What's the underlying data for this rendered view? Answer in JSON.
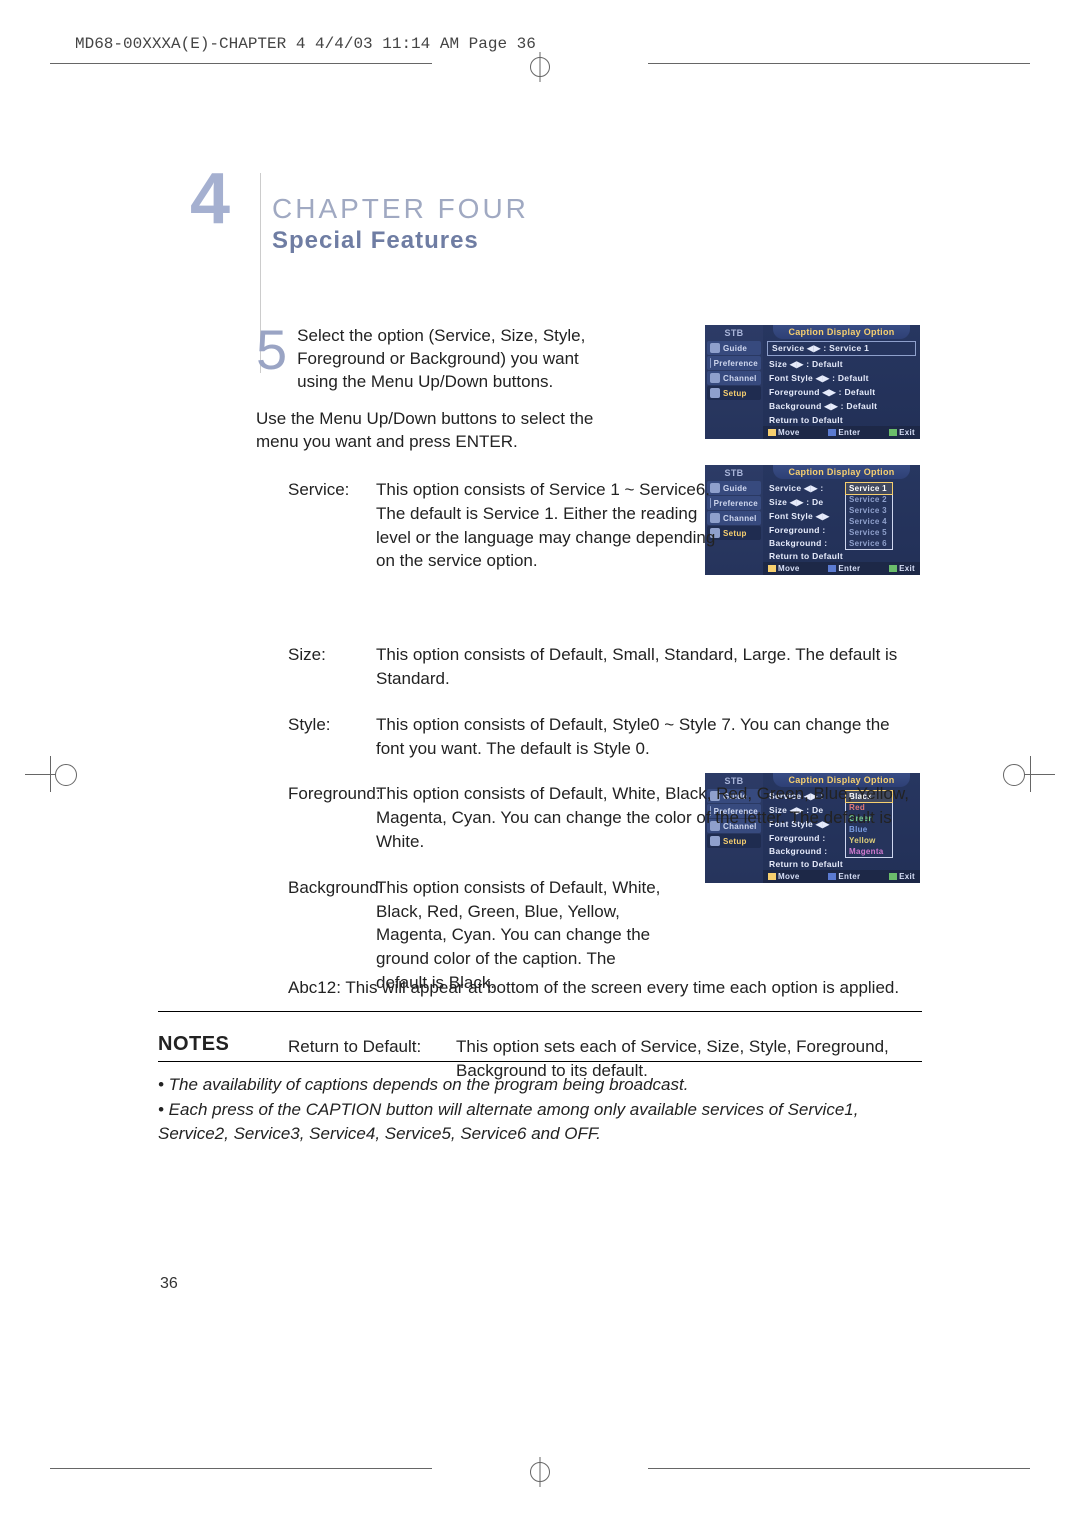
{
  "doc_header": "MD68-00XXXA(E)-CHAPTER 4  4/4/03  11:14 AM  Page 36",
  "chapter_number": "4",
  "chapter_title": "CHAPTER FOUR",
  "section_title": "Special Features",
  "step_number": "5",
  "step_text_1": "Select the option (Service, Size, Style, Foreground or Background) you want using the Menu Up/Down buttons.",
  "step_text_2": "Use the Menu Up/Down buttons to select the menu you want and press ENTER.",
  "defs": {
    "service_label": "Service:",
    "service_text": "This option consists of Service 1 ~ Service6. The default is Service 1. Either the reading level or the language may change depending on the service option.",
    "size_label": "Size:",
    "size_text": "This option consists of Default, Small, Standard, Large. The default is Standard.",
    "style_label": "Style:",
    "style_text": "This option consists of Default, Style0 ~ Style 7. You can change the font you want. The default is Style 0.",
    "fg_label": "Foreground:",
    "fg_text": "This option consists of Default, White, Black, Red, Green, Blue, Yellow, Magenta, Cyan. You can change the color of the letter. The default is White.",
    "bg_label": "Background:",
    "bg_text": "This option consists of Default, White, Black, Red, Green, Blue, Yellow, Magenta, Cyan. You can change the ground color of the caption. The default is Black.",
    "rtd_label": "Return to Default:",
    "rtd_text": "This option sets each of Service, Size, Style, Foreground, Background to its default."
  },
  "abc_line": "Abc12: This will appear at bottom of the screen every time each option is applied.",
  "notes_head": "NOTES",
  "notes": [
    "• The availability of captions depends on the program being broadcast.",
    "• Each press of the CAPTION button will alternate among only available services of Service1, Service2, Service3, Service4, Service5, Service6 and OFF."
  ],
  "page_number": "36",
  "osd": {
    "stb": "STB",
    "title": "Caption Display Option",
    "side_items": [
      "Guide",
      "Preference",
      "Channel",
      "Setup"
    ],
    "lines_default": [
      "Service ◀▶ : Service 1",
      "Size ◀▶ : Default",
      "Font Style ◀▶ : Default",
      "Foreground ◀▶ : Default",
      "Background ◀▶ : Default",
      "Return to Default"
    ],
    "lines_short": [
      "Service ◀▶ :",
      "Size ◀▶ : De",
      "Font Style ◀▶",
      "Foreground :",
      "Background :",
      "Return to Default"
    ],
    "footer_move": "Move",
    "footer_enter": "Enter",
    "footer_exit": "Exit",
    "popup_service": [
      "Service 1",
      "Service 2",
      "Service 3",
      "Service 4",
      "Service 5",
      "Service 6"
    ],
    "popup_color": [
      "Black",
      "Red",
      "Green",
      "Blue",
      "Yellow",
      "Magenta"
    ]
  }
}
